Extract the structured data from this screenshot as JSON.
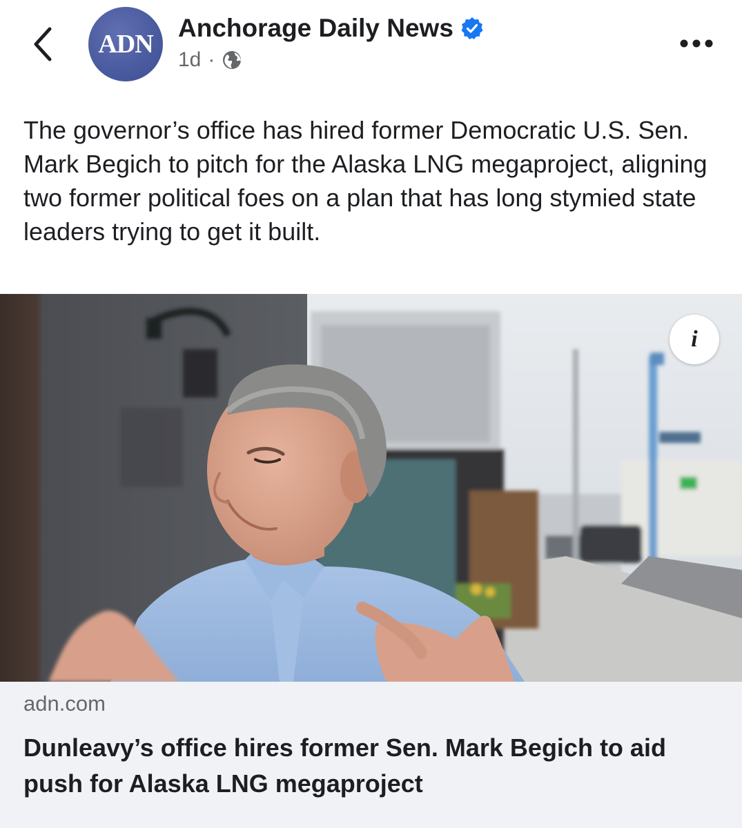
{
  "header": {
    "back_icon": "chevron-left-icon",
    "avatar_text": "ADN",
    "page_name": "Anchorage Daily News",
    "verified_icon": "verified-badge-icon",
    "timestamp": "1d",
    "separator": "·",
    "audience_icon": "globe-icon",
    "more_icon": "more-horizontal-icon"
  },
  "post": {
    "text": "The governor’s office has hired former Democratic U.S. Sen. Mark Begich to pitch for the Alaska LNG megaproject, aligning two former political foes on a plan that has long stymied state leaders trying to get it built."
  },
  "media": {
    "info_label": "i"
  },
  "link_preview": {
    "domain": "adn.com",
    "title": "Dunleavy’s office hires former Sen. Mark Begich to aid push for Alaska LNG megaproject"
  },
  "colors": {
    "accent_blue": "#1877f2",
    "avatar_blue": "#4a5a9e",
    "secondary_text": "#65676b",
    "card_background": "#f0f2f5"
  }
}
